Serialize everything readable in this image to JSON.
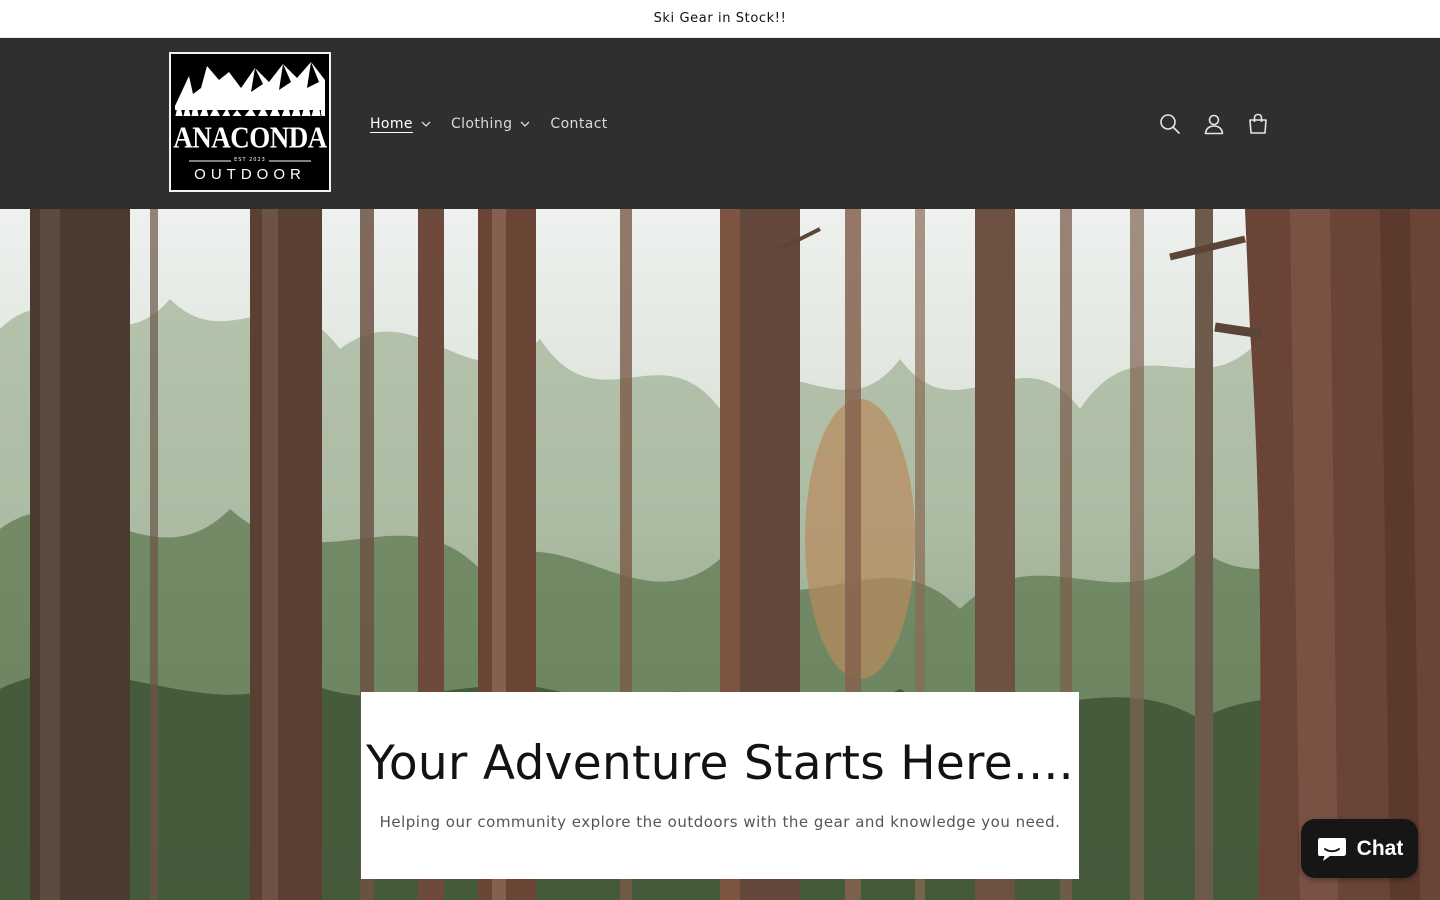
{
  "announcement": {
    "text": "Ski Gear in Stock!!"
  },
  "header": {
    "logo": {
      "main": "ANACONDA",
      "est": "EST 2023",
      "sub": "OUTDOOR"
    },
    "nav": [
      {
        "label": "Home",
        "has_dropdown": true,
        "active": true
      },
      {
        "label": "Clothing",
        "has_dropdown": true,
        "active": false
      },
      {
        "label": "Contact",
        "has_dropdown": false,
        "active": false
      }
    ],
    "icons": [
      "search-icon",
      "account-icon",
      "cart-icon"
    ]
  },
  "hero": {
    "title": "Your Adventure Starts Here....",
    "subtitle": "Helping our community explore the outdoors with the gear and knowledge you need."
  },
  "chat": {
    "label": "Chat",
    "icon": "chat-bubble-icon"
  },
  "colors": {
    "header_bg": "#2f2f2f",
    "chat_bg": "#161616",
    "text": "#121212"
  }
}
